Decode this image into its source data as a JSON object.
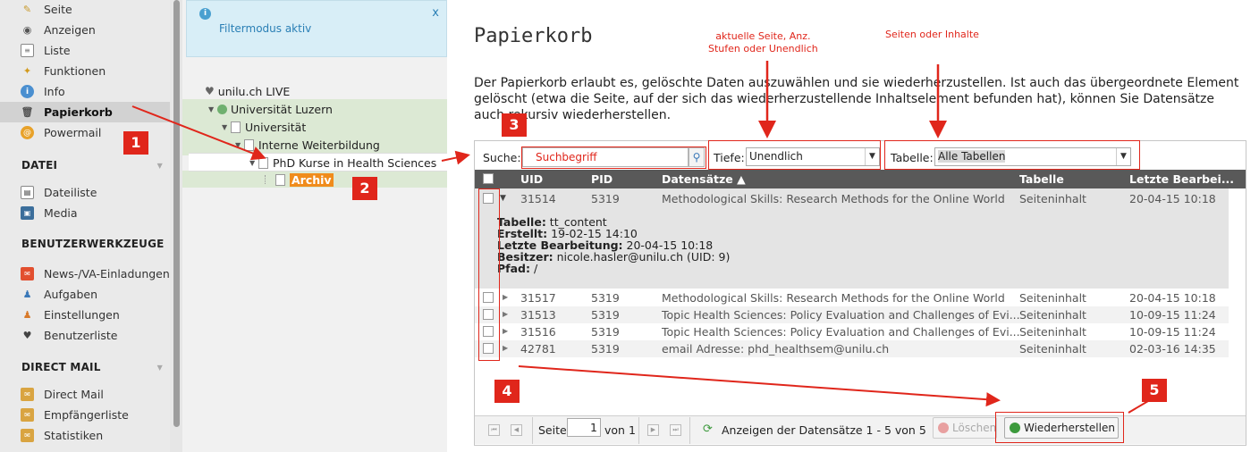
{
  "modules": {
    "items": [
      {
        "label": "Seite",
        "icon": "pencil-icon"
      },
      {
        "label": "Anzeigen",
        "icon": "eye-icon"
      },
      {
        "label": "Liste",
        "icon": "list-icon"
      },
      {
        "label": "Funktionen",
        "icon": "wand-icon"
      },
      {
        "label": "Info",
        "icon": "info-icon"
      },
      {
        "label": "Papierkorb",
        "icon": "trash-icon"
      },
      {
        "label": "Powermail",
        "icon": "powermail-icon"
      }
    ],
    "sections": [
      {
        "label": "DATEI",
        "items": [
          {
            "label": "Dateiliste",
            "icon": "filelist-icon"
          },
          {
            "label": "Media",
            "icon": "media-icon"
          }
        ]
      },
      {
        "label": "BENUTZERWERKZEUGE",
        "items": [
          {
            "label": "News-/VA-Einladungen",
            "icon": "news-icon"
          },
          {
            "label": "Aufgaben",
            "icon": "tasks-icon"
          },
          {
            "label": "Einstellungen",
            "icon": "settings-icon"
          },
          {
            "label": "Benutzerliste",
            "icon": "userlist-icon"
          }
        ]
      },
      {
        "label": "DIRECT MAIL",
        "items": [
          {
            "label": "Direct Mail",
            "icon": "mail-icon"
          },
          {
            "label": "Empfängerliste",
            "icon": "recipients-icon"
          },
          {
            "label": "Statistiken",
            "icon": "stats-icon"
          }
        ]
      }
    ]
  },
  "tree": {
    "filter_text": "Filtermodus aktiv",
    "close_label": "x",
    "nodes": [
      "unilu.ch LIVE",
      "Universität Luzern",
      "Universität",
      "Interne Weiterbildung",
      "PhD Kurse in Health Sciences",
      "Archiv"
    ]
  },
  "main": {
    "title": "Papierkorb",
    "description": "Der Papierkorb erlaubt es, gelöschte Daten auszuwählen und sie wiederherzustellen. Ist auch das übergeordnete Element gelöscht (etwa die Seite, auf der sich das wiederherzustellende Inhaltselement befunden hat), können Sie Datensätze auch rekursiv wiederherstellen.",
    "search_label": "Suche:",
    "search_placeholder": "Suchbegriff",
    "depth_label": "Tiefe:",
    "depth_value": "Unendlich",
    "table_label": "Tabelle:",
    "table_value": "Alle Tabellen",
    "columns": [
      "UID",
      "PID",
      "Datensätze ▲",
      "Tabelle",
      "Letzte Bearbei..."
    ],
    "expanded_row": {
      "uid": "31514",
      "pid": "5319",
      "record": "Methodological Skills: Research Methods for the Online World",
      "table": "Seiteninhalt",
      "date": "20-04-15 10:18"
    },
    "details": [
      {
        "k": "Tabelle:",
        "v": " tt_content"
      },
      {
        "k": "Erstellt:",
        "v": " 19-02-15 14:10"
      },
      {
        "k": "Letzte Bearbeitung:",
        "v": " 20-04-15 10:18"
      },
      {
        "k": "Besitzer:",
        "v": " nicole.hasler@unilu.ch (UID: 9)"
      },
      {
        "k": "Pfad:",
        "v": " /"
      }
    ],
    "rows": [
      {
        "uid": "31517",
        "pid": "5319",
        "record": "Methodological Skills: Research Methods for the Online World",
        "table": "Seiteninhalt",
        "date": "20-04-15 10:18"
      },
      {
        "uid": "31513",
        "pid": "5319",
        "record": "Topic Health Sciences: Policy Evaluation and Challenges of Evi...",
        "table": "Seiteninhalt",
        "date": "10-09-15 11:24"
      },
      {
        "uid": "31516",
        "pid": "5319",
        "record": "Topic Health Sciences: Policy Evaluation and Challenges of Evi...",
        "table": "Seiteninhalt",
        "date": "10-09-15 11:24"
      },
      {
        "uid": "42781",
        "pid": "5319",
        "record": "email Adresse: phd_healthsem@unilu.ch",
        "table": "Seiteninhalt",
        "date": "02-03-16 14:35"
      }
    ],
    "pager": {
      "page_label": "Seite",
      "page_value": "1",
      "of_label": "von 1",
      "info": "Anzeigen der Datensätze 1 - 5 von 5",
      "delete_label": "Löschen",
      "restore_label": "Wiederherstellen"
    }
  },
  "annotations": {
    "depth_note": "aktuelle Seite, Anz.\nStufen oder Unendlich",
    "table_note": "Seiten oder Inhalte",
    "badges": [
      "1",
      "2",
      "3",
      "4",
      "5"
    ]
  },
  "colors": {
    "annotation": "#e0261b",
    "header": "#595959",
    "tree_highlight": "#dce9d4"
  }
}
